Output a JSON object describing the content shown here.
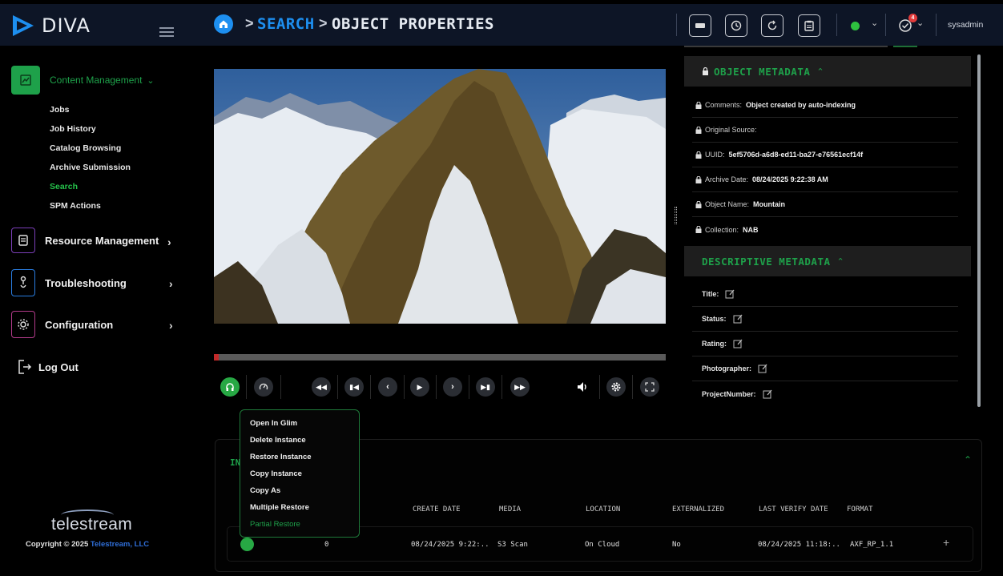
{
  "app": {
    "name": "DIVA"
  },
  "sidebar": {
    "content_management": "Content Management",
    "sub_items": [
      "Jobs",
      "Job History",
      "Catalog Browsing",
      "Archive Submission",
      "Search",
      "SPM Actions"
    ],
    "active_sub_item": "Search",
    "resource_management": "Resource Management",
    "troubleshooting": "Troubleshooting",
    "configuration": "Configuration",
    "logout": "Log Out",
    "footer_logo": "telestream",
    "copyright_prefix": "Copyright © 2025",
    "copyright_company": "Telestream, LLC"
  },
  "header": {
    "breadcrumb": [
      "SEARCH",
      "OBJECT PROPERTIES"
    ],
    "breadcrumb_sep": ">",
    "notification_count": "4",
    "user": "sysadmin",
    "status_color": "#2ec23f"
  },
  "player": {
    "progress": 0.01,
    "controls": [
      "headphones-icon",
      "speed-icon",
      "fast-rewind-icon",
      "skip-start-icon",
      "step-back-icon",
      "play-icon",
      "step-forward-icon",
      "skip-end-icon",
      "fast-forward-icon",
      "volume-icon",
      "settings-icon",
      "fullscreen-icon"
    ]
  },
  "object_metadata": {
    "title": "OBJECT METADATA",
    "rows": [
      {
        "key": "Comments:",
        "value": "Object created by auto-indexing"
      },
      {
        "key": "Original Source:",
        "value": ""
      },
      {
        "key": "UUID:",
        "value": "5ef5706d-a6d8-ed11-ba27-e76561ecf14f"
      },
      {
        "key": "Archive Date:",
        "value": "08/24/2025 9:22:38 AM"
      },
      {
        "key": "Object Name:",
        "value": "Mountain"
      },
      {
        "key": "Collection:",
        "value": "NAB"
      }
    ]
  },
  "descriptive_metadata": {
    "title": "DESCRIPTIVE METADATA",
    "rows": [
      "Title:",
      "Status:",
      "Rating:",
      "Photographer:",
      "ProjectNumber:"
    ]
  },
  "instances": {
    "title": "IN",
    "columns": [
      "CREATE DATE",
      "MEDIA",
      "LOCATION",
      "EXTERNALIZED",
      "LAST VERIFY DATE",
      "FORMAT"
    ],
    "row": {
      "id": "0",
      "create_date": "08/24/2025 9:22:..",
      "media": "S3 Scan",
      "location": "On Cloud",
      "externalized": "No",
      "last_verify": "08/24/2025 11:18:..",
      "format": "AXF_RP_1.1"
    }
  },
  "context_menu": {
    "items": [
      "Open In Glim",
      "Delete Instance",
      "Restore Instance",
      "Copy Instance",
      "Copy As",
      "Multiple Restore",
      "Partial Restore"
    ],
    "active": "Partial Restore"
  },
  "colors": {
    "accent": "#1ea14a",
    "header_bg": "#0d1526",
    "link": "#1d8ff0"
  }
}
